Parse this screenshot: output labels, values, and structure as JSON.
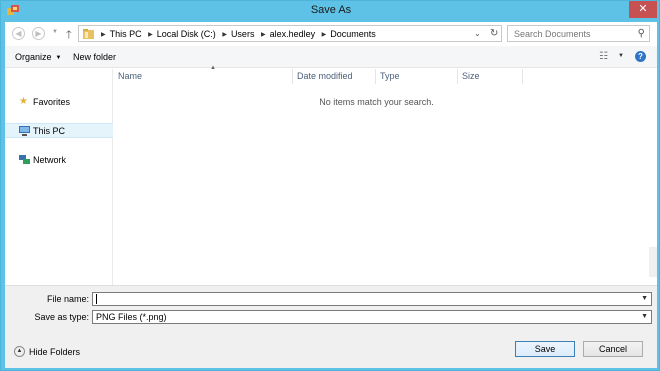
{
  "window": {
    "title": "Save As",
    "close_glyph": "✕"
  },
  "nav": {
    "back_icon": "back-arrow-icon",
    "forward_icon": "forward-arrow-icon",
    "up_icon": "up-arrow-icon"
  },
  "address": {
    "crumbs": [
      "This PC",
      "Local Disk (C:)",
      "Users",
      "alex.hedley",
      "Documents"
    ]
  },
  "search": {
    "placeholder": "Search Documents"
  },
  "toolbar": {
    "organize_label": "Organize",
    "new_folder_label": "New folder"
  },
  "sidebar": {
    "items": [
      {
        "label": "Favorites",
        "icon": "star-icon"
      },
      {
        "label": "This PC",
        "icon": "computer-icon",
        "selected": true
      },
      {
        "label": "Network",
        "icon": "network-icon"
      }
    ]
  },
  "filelist": {
    "columns": [
      "Name",
      "Date modified",
      "Type",
      "Size"
    ],
    "empty_message": "No items match your search."
  },
  "form": {
    "file_name_label": "File name:",
    "file_name_value": "",
    "save_type_label": "Save as type:",
    "save_type_value": "PNG Files (*.png)"
  },
  "footer": {
    "hide_folders_label": "Hide Folders",
    "save_label": "Save",
    "cancel_label": "Cancel"
  },
  "colors": {
    "titlebar": "#5ec2e6",
    "close": "#c75050",
    "help": "#2f74c9"
  }
}
